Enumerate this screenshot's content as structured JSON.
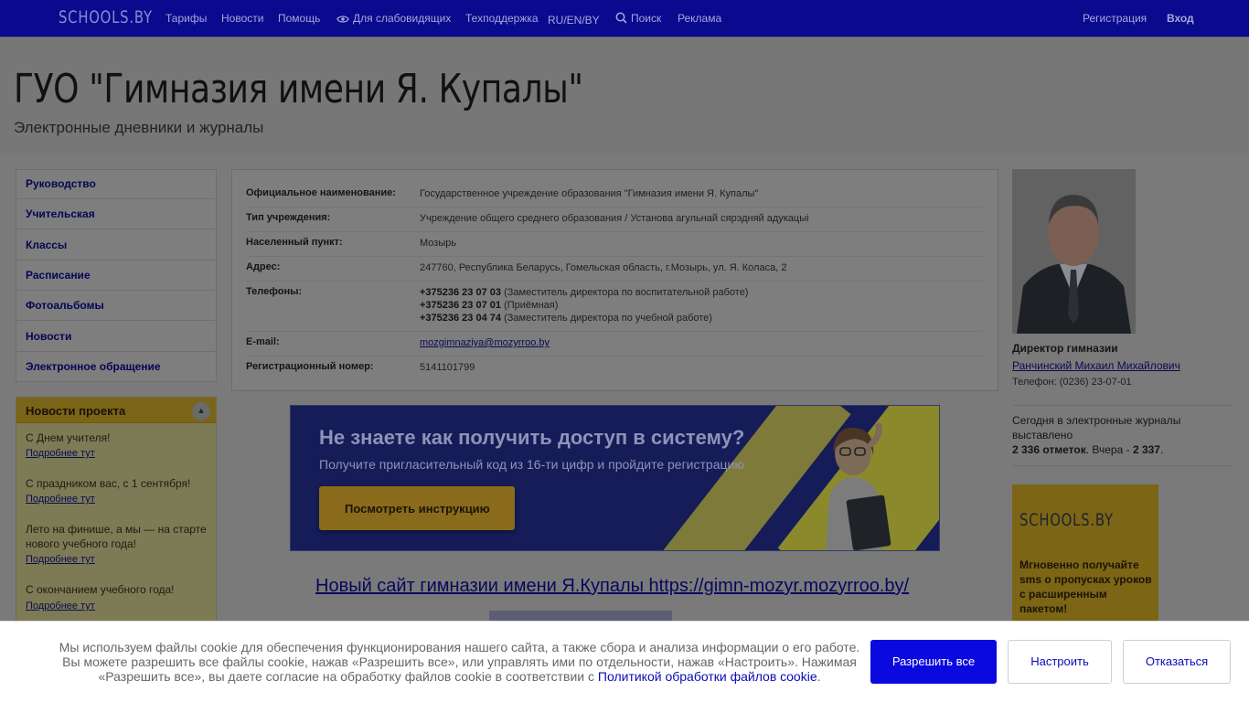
{
  "topnav": {
    "logo": "SCHOOLS.BY",
    "items": [
      {
        "label": "Тарифы"
      },
      {
        "label": "Новости"
      },
      {
        "label": "Помощь"
      },
      {
        "label": "Для слабовидящих",
        "icon": "eye-icon"
      },
      {
        "label": "Техподдержка"
      },
      {
        "label": "RU/EN/BY"
      },
      {
        "label": "Поиск",
        "icon": "search-icon"
      },
      {
        "label": "Реклама"
      }
    ],
    "register": "Регистрация",
    "login": "Вход"
  },
  "header": {
    "title": "ГУО \"Гимназия имени Я. Купалы\"",
    "subtitle": "Электронные дневники и журналы"
  },
  "sidebar": {
    "items": [
      {
        "label": "Руководство"
      },
      {
        "label": "Учительская"
      },
      {
        "label": "Классы"
      },
      {
        "label": "Расписание"
      },
      {
        "label": "Фотоальбомы"
      },
      {
        "label": "Новости"
      },
      {
        "label": "Электронное обращение"
      }
    ]
  },
  "news": {
    "heading": "Новости проекта",
    "more_label": "Подробнее тут",
    "items": [
      {
        "title": "С Днем учителя!"
      },
      {
        "title": "С праздником вас, с 1 сентября!"
      },
      {
        "title": "Лето на финише, а мы — на старте нового учебного года!"
      },
      {
        "title": "С окончанием учебного года!"
      }
    ]
  },
  "info": {
    "rows": [
      {
        "label": "Официальное наименование:",
        "value": "Государственное учреждение образования \"Гимназия имени Я. Купалы\""
      },
      {
        "label": "Тип учреждения:",
        "value": "Учреждение общего среднего образования / Установа агульнай сярэдняй адукацыі"
      },
      {
        "label": "Населенный пункт:",
        "value": "Мозырь"
      },
      {
        "label": "Адрес:",
        "value": "247760, Республика Беларусь, Гомельская область, г.Мозырь, ул. Я. Коласа, 2"
      }
    ],
    "phones_label": "Телефоны:",
    "phones": [
      {
        "number": "+375236 23 07 03",
        "note": "(Заместитель директора по воспитательной работе)"
      },
      {
        "number": "+375236 23 07 01",
        "note": "(Приёмная)"
      },
      {
        "number": "+375236 23 04 74",
        "note": "(Заместитель директора по учебной работе)"
      }
    ],
    "email_label": "E-mail:",
    "email": "mozgimnaziya@mozyrroo.by",
    "reg_label": "Регистрационный номер:",
    "reg_number": "5141101799"
  },
  "banner": {
    "title": "Не знаете как получить доступ в систему?",
    "subtitle": "Получите пригласительный код из 16-ти цифр и пройдите регистрацию",
    "button": "Посмотреть инструкцию"
  },
  "newsite_link": "Новый сайт гимназии имени Я.Купалы https://gimn-mozyr.mozyrroo.by/",
  "director": {
    "title": "Директор гимназии",
    "name": "Ранчинский Михаил Михайлович",
    "phone": "Телефон: (0236) 23-07-01"
  },
  "stats": {
    "prefix": "Сегодня в электронные журналы выставлено",
    "today": "2 336 отметок",
    "middle": ". Вчера - ",
    "yesterday": "2 337",
    "suffix": "."
  },
  "ad": {
    "logo": "SCHOOLS.BY",
    "text": "Мгновенно получайте sms о пропусках уроков с расширенным пакетом!"
  },
  "cookie": {
    "text": "Мы используем файлы cookie для обеспечения функционирования нашего сайта, а также сбора и анализа информации о его работе. Вы можете разрешить все файлы cookie, нажав «Разрешить все», или управлять ими по отдельности, нажав «Настроить». Нажимая «Разрешить все», вы даете согласие на обработку файлов cookie в соответствии с ",
    "link": "Политикой обработки файлов cookie",
    "end": ".",
    "allow": "Разрешить все",
    "settings": "Настроить",
    "decline": "Отказаться"
  }
}
